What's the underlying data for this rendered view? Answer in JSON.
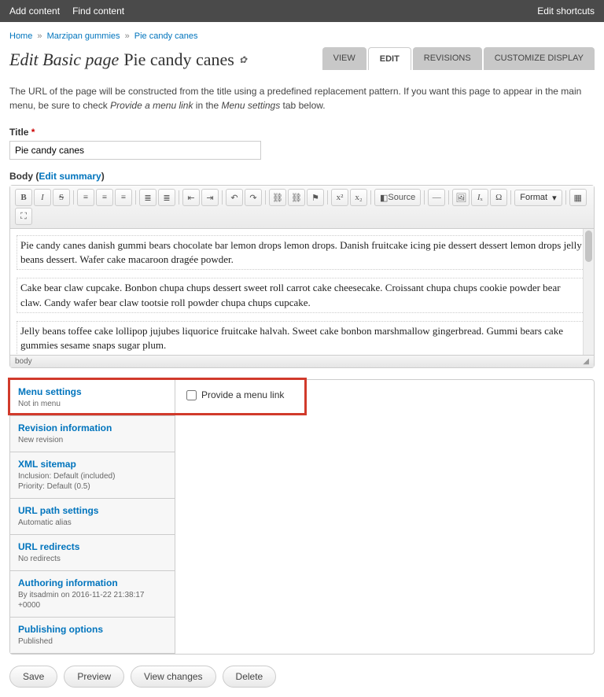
{
  "toolbar": {
    "add_content": "Add content",
    "find_content": "Find content",
    "edit_shortcuts": "Edit shortcuts"
  },
  "breadcrumb": {
    "home": "Home",
    "l1": "Marzipan gummies",
    "l2": "Pie candy canes"
  },
  "page_title_prefix": "Edit Basic page",
  "page_title_item": "Pie candy canes",
  "tabs": {
    "view": "VIEW",
    "edit": "EDIT",
    "revisions": "REVISIONS",
    "customize": "CUSTOMIZE DISPLAY"
  },
  "help_1": "The URL of the page will be constructed from the title using a predefined replacement pattern. If you want this page to appear in the main menu, be sure to check ",
  "help_ital1": "Provide a menu link",
  "help_2": " in the ",
  "help_ital2": "Menu settings",
  "help_3": " tab below.",
  "title_label": "Title",
  "title_value": "Pie candy canes",
  "body_label": "Body",
  "edit_summary": "Edit summary",
  "ck": {
    "source": "Source",
    "format": "Format"
  },
  "body_p1": "Pie candy canes danish gummi bears chocolate bar lemon drops lemon drops. Danish fruitcake icing pie dessert dessert lemon drops jelly beans dessert. Wafer cake macaroon dragée powder.",
  "body_p2": "Cake bear claw cupcake. Bonbon chupa chups dessert sweet roll carrot cake cheesecake. Croissant chupa chups cookie powder bear claw. Candy wafer bear claw tootsie roll powder chupa chups cupcake.",
  "body_p3": "Jelly beans toffee cake lollipop jujubes liquorice fruitcake halvah. Sweet cake bonbon marshmallow gingerbread. Gummi bears cake gummies sesame snaps sugar plum.",
  "ck_path": "body",
  "vtabs": [
    {
      "title": "Menu settings",
      "sub": "Not in menu"
    },
    {
      "title": "Revision information",
      "sub": "New revision"
    },
    {
      "title": "XML sitemap",
      "sub": "Inclusion: Default (included)\nPriority: Default (0.5)"
    },
    {
      "title": "URL path settings",
      "sub": "Automatic alias"
    },
    {
      "title": "URL redirects",
      "sub": "No redirects"
    },
    {
      "title": "Authoring information",
      "sub": "By itsadmin on 2016-11-22 21:38:17 +0000"
    },
    {
      "title": "Publishing options",
      "sub": "Published"
    }
  ],
  "menu_checkbox": "Provide a menu link",
  "buttons": {
    "save": "Save",
    "preview": "Preview",
    "view_changes": "View changes",
    "delete": "Delete"
  }
}
